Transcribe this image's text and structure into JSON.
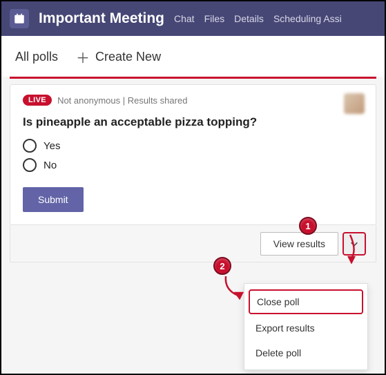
{
  "header": {
    "title": "Important Meeting",
    "tabs": [
      "Chat",
      "Files",
      "Details",
      "Scheduling Assi"
    ]
  },
  "subheader": {
    "all_polls": "All polls",
    "create_new": "Create New"
  },
  "poll": {
    "live_label": "LIVE",
    "status": "Not anonymous | Results shared",
    "question": "Is pineapple an acceptable pizza topping?",
    "options": [
      "Yes",
      "No"
    ],
    "submit_label": "Submit",
    "view_results_label": "View results"
  },
  "menu": {
    "items": [
      "Close poll",
      "Export results",
      "Delete poll"
    ]
  },
  "callouts": {
    "one": "1",
    "two": "2"
  }
}
